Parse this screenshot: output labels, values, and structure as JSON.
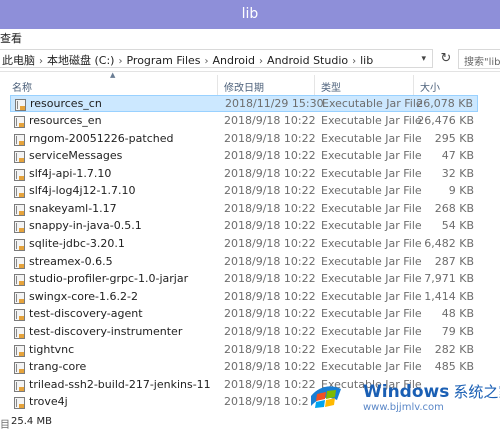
{
  "window": {
    "title": "lib"
  },
  "menu": {
    "view": "查看"
  },
  "address": {
    "crumbs": [
      "此电脑",
      "本地磁盘 (C:)",
      "Program Files",
      "Android",
      "Android Studio",
      "lib"
    ],
    "search_placeholder": "搜索\"lib\""
  },
  "columns": {
    "name": "名称",
    "date": "修改日期",
    "type": "类型",
    "size": "大小"
  },
  "files": [
    {
      "name": "resources_cn",
      "date": "2018/11/29 15:30",
      "type": "Executable Jar File",
      "size": "26,078 KB",
      "selected": true
    },
    {
      "name": "resources_en",
      "date": "2018/9/18 10:22",
      "type": "Executable Jar File",
      "size": "26,476 KB"
    },
    {
      "name": "rngom-20051226-patched",
      "date": "2018/9/18 10:22",
      "type": "Executable Jar File",
      "size": "295 KB"
    },
    {
      "name": "serviceMessages",
      "date": "2018/9/18 10:22",
      "type": "Executable Jar File",
      "size": "47 KB"
    },
    {
      "name": "slf4j-api-1.7.10",
      "date": "2018/9/18 10:22",
      "type": "Executable Jar File",
      "size": "32 KB"
    },
    {
      "name": "slf4j-log4j12-1.7.10",
      "date": "2018/9/18 10:22",
      "type": "Executable Jar File",
      "size": "9 KB"
    },
    {
      "name": "snakeyaml-1.17",
      "date": "2018/9/18 10:22",
      "type": "Executable Jar File",
      "size": "268 KB"
    },
    {
      "name": "snappy-in-java-0.5.1",
      "date": "2018/9/18 10:22",
      "type": "Executable Jar File",
      "size": "54 KB"
    },
    {
      "name": "sqlite-jdbc-3.20.1",
      "date": "2018/9/18 10:22",
      "type": "Executable Jar File",
      "size": "6,482 KB"
    },
    {
      "name": "streamex-0.6.5",
      "date": "2018/9/18 10:22",
      "type": "Executable Jar File",
      "size": "287 KB"
    },
    {
      "name": "studio-profiler-grpc-1.0-jarjar",
      "date": "2018/9/18 10:22",
      "type": "Executable Jar File",
      "size": "7,971 KB"
    },
    {
      "name": "swingx-core-1.6.2-2",
      "date": "2018/9/18 10:22",
      "type": "Executable Jar File",
      "size": "1,414 KB"
    },
    {
      "name": "test-discovery-agent",
      "date": "2018/9/18 10:22",
      "type": "Executable Jar File",
      "size": "48 KB"
    },
    {
      "name": "test-discovery-instrumenter",
      "date": "2018/9/18 10:22",
      "type": "Executable Jar File",
      "size": "79 KB"
    },
    {
      "name": "tightvnc",
      "date": "2018/9/18 10:22",
      "type": "Executable Jar File",
      "size": "282 KB"
    },
    {
      "name": "trang-core",
      "date": "2018/9/18 10:22",
      "type": "Executable Jar File",
      "size": "485 KB"
    },
    {
      "name": "trilead-ssh2-build-217-jenkins-11",
      "date": "2018/9/18 10:22",
      "type": "Executable Jar File",
      "size": ""
    },
    {
      "name": "trove4j",
      "date": "2018/9/18 10:2",
      "type": "",
      "size": ""
    }
  ],
  "status": {
    "count": "目",
    "selected_size": "25.4 MB"
  },
  "watermark": {
    "brand": "Windows",
    "brand_cn": "系统之家",
    "url": "www.bjjmlv.com"
  },
  "colors": {
    "titlebar": "#8e8fd9",
    "selection": "#cce8ff",
    "selection_border": "#99d1ff"
  }
}
